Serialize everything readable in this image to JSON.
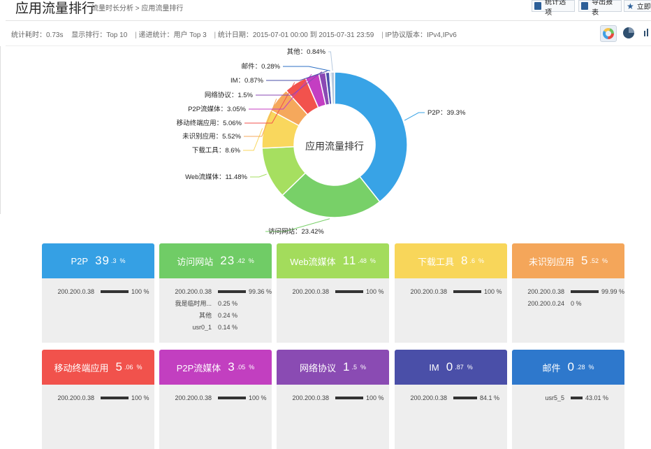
{
  "header": {
    "title": "应用流量排行",
    "breadcrumb": [
      "流量时长分析",
      "应用流量排行"
    ],
    "breadcrumb_sep": ">",
    "buttons": [
      {
        "label": "统计选项",
        "icon": "stats-icon"
      },
      {
        "label": "导出报表",
        "icon": "export-icon"
      },
      {
        "label": "立即",
        "icon": "star-icon"
      }
    ]
  },
  "info": {
    "items": [
      "统计耗时：0.73s",
      "显示排行：Top 10",
      "递进统计：用户 Top 3",
      "统计日期：2015-07-01 00:00 到 2015-07-31 23:59",
      "IP协议版本：IPv4,IPv6"
    ],
    "separator": "|",
    "view_buttons": [
      {
        "name": "donut-view",
        "icon": "donut-icon",
        "active": true
      },
      {
        "name": "pie-view",
        "icon": "pie-icon",
        "active": false
      },
      {
        "name": "bar-view",
        "icon": "bar-icon",
        "active": false
      }
    ]
  },
  "chart_data": {
    "type": "pie",
    "center_label": "应用流量排行",
    "slices": [
      {
        "label": "P2P",
        "value": 39.3,
        "color": "#38a3e6"
      },
      {
        "label": "访问网站",
        "value": 23.42,
        "color": "#78d068"
      },
      {
        "label": "Web流媒体",
        "value": 11.48,
        "color": "#a6df60"
      },
      {
        "label": "下载工具",
        "value": 8.6,
        "color": "#f9d75d"
      },
      {
        "label": "未识别应用",
        "value": 5.52,
        "color": "#f5a85c"
      },
      {
        "label": "移动终端应用",
        "value": 5.06,
        "color": "#f2524d"
      },
      {
        "label": "P2P流媒体",
        "value": 3.05,
        "color": "#c43ec2"
      },
      {
        "label": "网络协议",
        "value": 1.5,
        "color": "#8a49b4"
      },
      {
        "label": "IM",
        "value": 0.87,
        "color": "#4a4faa"
      },
      {
        "label": "邮件",
        "value": 0.28,
        "color": "#2c6fc4"
      },
      {
        "label": "其他",
        "value": 0.84,
        "color": "#b6c9df"
      }
    ]
  },
  "cards": [
    {
      "name": "P2P",
      "pct_int": "39",
      "pct_dec": ".3",
      "sym": "%",
      "color": "#35a0e4",
      "rows": [
        {
          "label": "200.200.0.38",
          "bar": 1.0,
          "value": "100 %"
        }
      ]
    },
    {
      "name": "访问网站",
      "pct_int": "23",
      "pct_dec": ".42",
      "sym": "%",
      "color": "#70cc66",
      "rows": [
        {
          "label": "200.200.0.38",
          "bar": 0.9936,
          "value": "99.36 %"
        },
        {
          "label": "我是临时用...",
          "bar": 0,
          "value": "0.25 %"
        },
        {
          "label": "其他",
          "bar": 0,
          "value": "0.24 %"
        },
        {
          "label": "usr0_1",
          "bar": 0,
          "value": "0.14 %"
        }
      ]
    },
    {
      "name": "Web流媒体",
      "pct_int": "11",
      "pct_dec": ".48",
      "sym": "%",
      "color": "#a3dc5c",
      "rows": [
        {
          "label": "200.200.0.38",
          "bar": 1.0,
          "value": "100 %"
        }
      ]
    },
    {
      "name": "下载工具",
      "pct_int": "8",
      "pct_dec": ".6",
      "sym": "%",
      "color": "#f8d65a",
      "rows": [
        {
          "label": "200.200.0.38",
          "bar": 1.0,
          "value": "100 %"
        }
      ]
    },
    {
      "name": "未识别应用",
      "pct_int": "5",
      "pct_dec": ".52",
      "sym": "%",
      "color": "#f4a65a",
      "rows": [
        {
          "label": "200.200.0.38",
          "bar": 0.9999,
          "value": "99.99 %"
        },
        {
          "label": "200.200.0.24",
          "bar": 0,
          "value": "0 %"
        }
      ]
    },
    {
      "name": "移动终端应用",
      "pct_int": "5",
      "pct_dec": ".06",
      "sym": "%",
      "color": "#f1524c",
      "rows": [
        {
          "label": "200.200.0.38",
          "bar": 1.0,
          "value": "100 %"
        }
      ]
    },
    {
      "name": "P2P流媒体",
      "pct_int": "3",
      "pct_dec": ".05",
      "sym": "%",
      "color": "#c23fc0",
      "rows": [
        {
          "label": "200.200.0.38",
          "bar": 1.0,
          "value": "100 %"
        }
      ]
    },
    {
      "name": "网络协议",
      "pct_int": "1",
      "pct_dec": ".5",
      "sym": "%",
      "color": "#8a4bb3",
      "rows": [
        {
          "label": "200.200.0.38",
          "bar": 1.0,
          "value": "100 %"
        }
      ]
    },
    {
      "name": "IM",
      "pct_int": "0",
      "pct_dec": ".87",
      "sym": "%",
      "color": "#4a4fa8",
      "rows": [
        {
          "label": "200.200.0.38",
          "bar": 0.841,
          "value": "84.1 %"
        }
      ]
    },
    {
      "name": "邮件",
      "pct_int": "0",
      "pct_dec": ".28",
      "sym": "%",
      "color": "#2e78cc",
      "rows": [
        {
          "label": "usr5_5",
          "bar": 0.4301,
          "value": "43.01 %"
        }
      ]
    }
  ]
}
